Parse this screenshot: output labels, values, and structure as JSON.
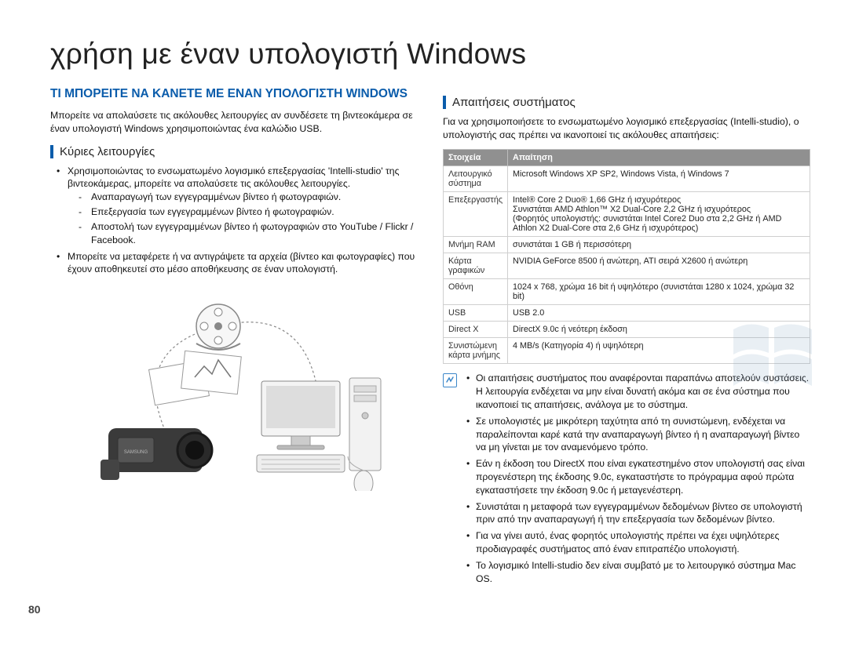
{
  "page_number": "80",
  "main_title": "χρήση με έναν υπολογιστή Windows",
  "left": {
    "section_heading": "ΤΙ ΜΠΟΡΕΙΤΕ ΝΑ ΚΑΝΕΤΕ ΜΕ ΕΝΑΝ ΥΠΟΛΟΓΙΣΤΗ WINDOWS",
    "intro": "Μπορείτε να απολαύσετε τις ακόλουθες λειτουργίες αν συνδέσετε τη βιντεοκάμερα σε έναν υπολογιστή Windows χρησιμοποιώντας ένα καλώδιο USB.",
    "sub_heading": "Κύριες λειτουργίες",
    "bullet1": "Χρησιμοποιώντας το ενσωματωμένο λογισμικό επεξεργασίας 'Intelli-studio' της βιντεοκάμερας, μπορείτε να απολαύσετε τις ακόλουθες λειτουργίες.",
    "dash1": "Αναπαραγωγή των εγγεγραμμένων βίντεο ή φωτογραφιών.",
    "dash2": "Επεξεργασία των εγγεγραμμένων βίντεο ή φωτογραφιών.",
    "dash3": "Αποστολή των εγγεγραμμένων βίντεο ή φωτογραφιών στο YouTube / Flickr / Facebook.",
    "bullet2": "Μπορείτε να μεταφέρετε ή να αντιγράψετε τα αρχεία (βίντεο και φωτογραφίες) που έχουν αποθηκευτεί στο μέσο αποθήκευσης σε έναν υπολογιστή."
  },
  "right": {
    "sub_heading": "Απαιτήσεις συστήματος",
    "intro": "Για να χρησιμοποιήσετε το ενσωματωμένο λογισμικό επεξεργασίας (Intelli-studio), ο υπολογιστής σας πρέπει να ικανοποιεί τις ακόλουθες απαιτήσεις:",
    "table": {
      "headers": [
        "Στοιχεία",
        "Απαίτηση"
      ],
      "rows": [
        {
          "k": "Λειτουργικό σύστημα",
          "v": "Microsoft Windows XP SP2, Windows Vista, ή Windows 7"
        },
        {
          "k": "Επεξεργαστής",
          "v": "Intel® Core 2 Duo® 1,66 GHz ή ισχυρότερος\nΣυνιστάται AMD Athlon™ X2 Dual-Core 2,2 GHz ή ισχυρότερος\n(Φορητός υπολογιστής: συνιστάται Intel Core2 Duo στα 2,2 GHz ή AMD Athlon X2 Dual-Core στα 2,6 GHz ή ισχυρότερος)"
        },
        {
          "k": "Μνήμη RAM",
          "v": "συνιστάται 1 GB ή περισσότερη"
        },
        {
          "k": "Κάρτα γραφικών",
          "v": "NVIDIA GeForce 8500 ή ανώτερη, ATI σειρά X2600 ή ανώτερη"
        },
        {
          "k": "Οθόνη",
          "v": "1024 x 768, χρώμα 16 bit ή υψηλότερο (συνιστάται 1280 x 1024, χρώμα 32 bit)"
        },
        {
          "k": "USB",
          "v": "USB 2.0"
        },
        {
          "k": "Direct X",
          "v": "DirectX 9.0c ή νεότερη έκδοση"
        },
        {
          "k": "Συνιστώμενη κάρτα μνήμης",
          "v": "4 MB/s (Κατηγορία 4) ή υψηλότερη"
        }
      ]
    },
    "notes": [
      "Οι απαιτήσεις συστήματος που αναφέρονται παραπάνω αποτελούν συστάσεις. Η λειτουργία ενδέχεται να μην είναι δυνατή ακόμα και σε ένα σύστημα που ικανοποιεί τις απαιτήσεις, ανάλογα με το σύστημα.",
      "Σε υπολογιστές με μικρότερη ταχύτητα από τη συνιστώμενη, ενδέχεται να παραλείπονται καρέ κατά την αναπαραγωγή βίντεο ή η αναπαραγωγή βίντεο να μη γίνεται με τον αναμενόμενο τρόπο.",
      "Εάν η έκδοση του DirectX που είναι εγκατεστημένο στον υπολογιστή σας είναι προγενέστερη της έκδοσης 9.0c, εγκαταστήστε το πρόγραμμα αφού πρώτα εγκαταστήσετε την έκδοση 9.0c ή μεταγενέστερη.",
      "Συνιστάται η μεταφορά των εγγεγραμμένων δεδομένων βίντεο σε υπολογιστή πριν από την αναπαραγωγή ή την επεξεργασία των δεδομένων βίντεο.",
      "Για να γίνει αυτό, ένας φορητός υπολογιστής πρέπει να έχει υψηλότερες προδιαγραφές συστήματος από έναν επιτραπέζιο υπολογιστή.",
      "Το λογισμικό Intelli-studio δεν είναι συμβατό με το λειτουργικό σύστημα Mac OS."
    ]
  }
}
